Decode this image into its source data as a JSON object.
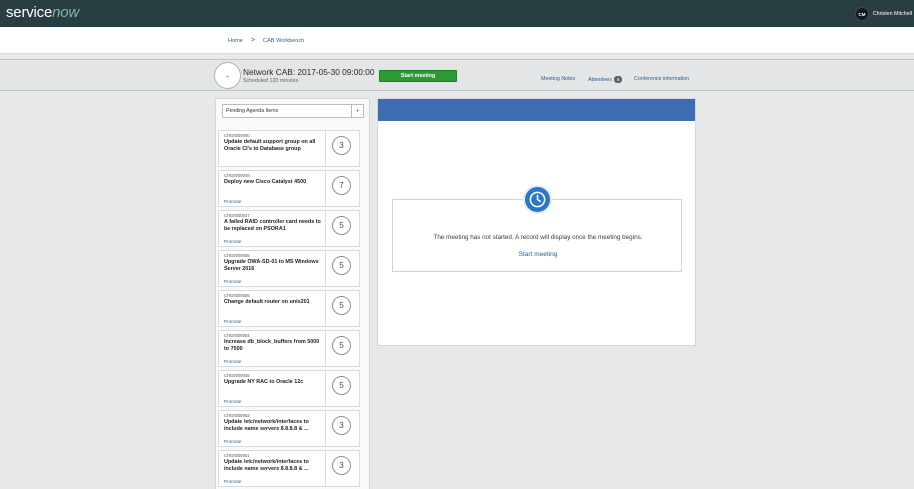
{
  "brand": {
    "part1": "service",
    "part2": "now"
  },
  "user": {
    "initials": "CM",
    "name": "Christen Mitchell"
  },
  "breadcrumb": {
    "home": "Home",
    "separator": ">",
    "current": "CAB Workbench"
  },
  "meeting": {
    "circle_text": "-",
    "title": "Network CAB: 2017-05-30 09:00:00",
    "subtitle": "Scheduled 120 minutes",
    "start_button": "Start meeting",
    "links": {
      "notes": "Meeting Notes",
      "attendees": "Attendees",
      "attendees_count": "8",
      "conference": "Conference information"
    }
  },
  "filter": {
    "selected": "Pending Agenda Items",
    "caret": "▾"
  },
  "agenda_items": [
    {
      "number": "CHG0000050",
      "title": "Update default support group on all Oracle CI's to Database group",
      "promote": "",
      "score": "3"
    },
    {
      "number": "CHG0000049",
      "title": "Deploy new Cisco Catalyst 4500",
      "promote": "Promote",
      "score": "7"
    },
    {
      "number": "CHG0000047",
      "title": "A failed RAID controller card needs to be replaced on PSORA1",
      "promote": "Promote",
      "score": "5"
    },
    {
      "number": "CHG0000055",
      "title": "Upgrade OWA-SD-01 to MS Windows Server 2016",
      "promote": "Promote",
      "score": "5"
    },
    {
      "number": "CHG0000056",
      "title": "Change default router on unix201",
      "promote": "Promote",
      "score": "5"
    },
    {
      "number": "CHG0000054",
      "title": "Increase db_block_buffers from 5000 to 7500",
      "promote": "Promote",
      "score": "5"
    },
    {
      "number": "CHG0000046",
      "title": "Upgrade NY RAC to Oracle 12c",
      "promote": "Promote",
      "score": "5"
    },
    {
      "number": "CHG0000053",
      "title": "Update /etc/network/interfaces to include name servers 8.8.8.8 & ...",
      "promote": "Promote",
      "score": "3"
    },
    {
      "number": "CHG0000051",
      "title": "Update /etc/network/interfaces to include name servers 8.8.8.8 & ...",
      "promote": "Promote",
      "score": "3"
    }
  ],
  "notice": {
    "message": "The meeting has not started. A record will display once the meeting begins.",
    "link": "Start meeting"
  },
  "colors": {
    "topbar": "#293e40",
    "brand_accent": "#81b5a1",
    "start_button": "#2c9b35",
    "panel_header": "#3f6db3",
    "clock": "#2a78c8",
    "link": "#2d5f8f"
  },
  "icons": {
    "clock": "clock-icon",
    "caret": "chevron-down-icon",
    "separator": "chevron-right-icon"
  }
}
